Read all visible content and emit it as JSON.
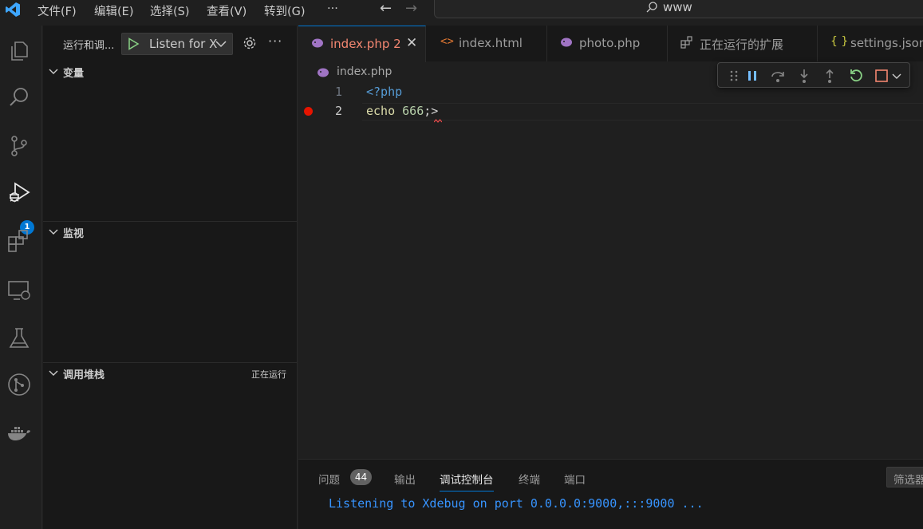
{
  "menu": [
    "文件(F)",
    "编辑(E)",
    "选择(S)",
    "查看(V)",
    "转到(G)"
  ],
  "menu_more": "···",
  "search": {
    "text": "www"
  },
  "activity_badge": "1",
  "sidebar": {
    "title": "运行和调...",
    "launch_config": "Listen for X",
    "sections": [
      {
        "title": "变量",
        "status": ""
      },
      {
        "title": "监视",
        "status": ""
      },
      {
        "title": "调用堆栈",
        "status": "正在运行"
      }
    ]
  },
  "tabs": [
    {
      "label": "index.php",
      "badge": "2",
      "icon": "php-elephant-icon",
      "active": true
    },
    {
      "label": "index.html",
      "icon": "html-icon"
    },
    {
      "label": "photo.php",
      "icon": "php-elephant-icon"
    },
    {
      "label": "正在运行的扩展",
      "icon": "extensions-icon"
    },
    {
      "label": "settings.json",
      "icon": "json-icon"
    }
  ],
  "breadcrumb": "index.php",
  "code": {
    "lines": [
      {
        "num": "1",
        "tokens": [
          {
            "t": "<?php",
            "c": "#569cd6"
          }
        ]
      },
      {
        "num": "2",
        "tokens": [
          {
            "t": "echo",
            "c": "#dcdcaa"
          },
          {
            "t": " ",
            "c": "#cccccc"
          },
          {
            "t": "666",
            "c": "#b5cea8"
          },
          {
            "t": ";>",
            "c": "#d4d4d4"
          }
        ]
      }
    ],
    "breakpoint_line": 2
  },
  "panel": {
    "tabs": [
      "问题",
      "输出",
      "调试控制台",
      "终端",
      "端口"
    ],
    "problems_count": "44",
    "active_tab": "调试控制台",
    "filter_placeholder": "筛选器",
    "console_output": "Listening to Xdebug on port 0.0.0.0:9000,:::9000 ..."
  },
  "colors": {
    "accent": "#0078d4",
    "breakpoint": "#e51400",
    "console": "#3794ff"
  }
}
